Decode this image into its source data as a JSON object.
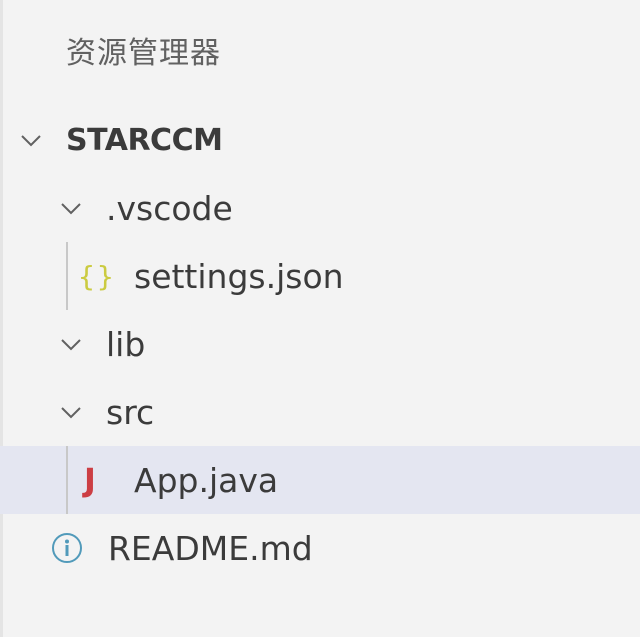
{
  "explorer": {
    "title": "资源管理器"
  },
  "tree": {
    "root": {
      "label": "STARCCM",
      "expanded": true
    },
    "vscode_folder": {
      "label": ".vscode",
      "expanded": true
    },
    "settings_file": {
      "label": "settings.json",
      "icon": "json-braces-icon",
      "icon_glyph": "{}"
    },
    "lib_folder": {
      "label": "lib",
      "expanded": true
    },
    "src_folder": {
      "label": "src",
      "expanded": true
    },
    "app_file": {
      "label": "App.java",
      "icon": "java-icon",
      "icon_glyph": "J",
      "selected": true
    },
    "readme_file": {
      "label": "README.md",
      "icon": "info-icon"
    }
  },
  "colors": {
    "background": "#f3f3f3",
    "selection": "#e4e6f1",
    "json_icon": "#cbcb41",
    "java_icon": "#cc3e44",
    "text": "#3b3b3b"
  }
}
